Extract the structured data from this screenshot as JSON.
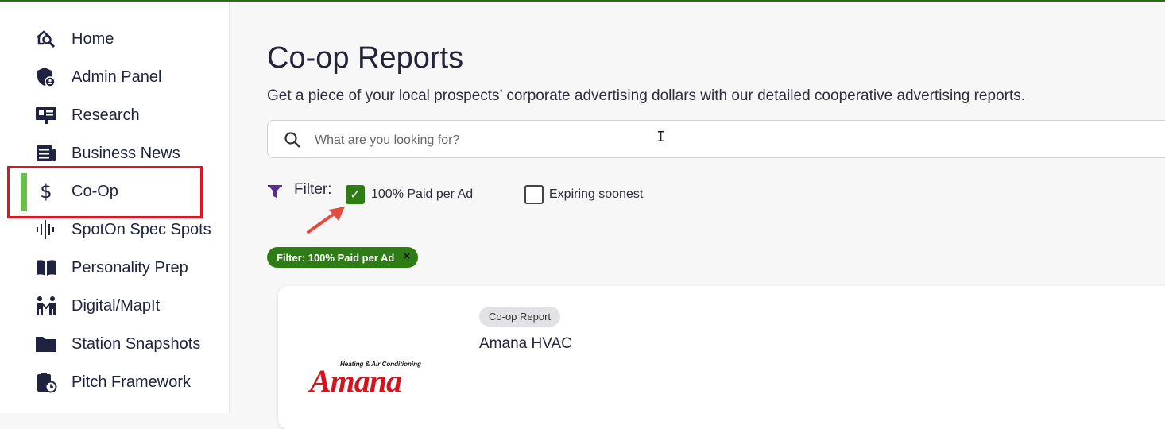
{
  "sidebar": {
    "items": [
      {
        "label": "Home",
        "icon": "home-search-icon"
      },
      {
        "label": "Admin Panel",
        "icon": "shield-user-icon"
      },
      {
        "label": "Research",
        "icon": "presentation-icon"
      },
      {
        "label": "Business News",
        "icon": "newspaper-icon"
      },
      {
        "label": "Co-Op",
        "icon": "dollar-icon",
        "active": true
      },
      {
        "label": "SpotOn Spec Spots",
        "icon": "soundwave-icon"
      },
      {
        "label": "Personality Prep",
        "icon": "open-book-icon"
      },
      {
        "label": "Digital/MapIt",
        "icon": "people-icon"
      },
      {
        "label": "Station Snapshots",
        "icon": "folder-icon"
      },
      {
        "label": "Pitch Framework",
        "icon": "clipboard-clock-icon"
      }
    ],
    "active_color": "#6abf4b",
    "highlight_color": "#e0141e"
  },
  "main": {
    "title": "Co-op Reports",
    "subtitle": "Get a piece of your local prospects’ corporate advertising dollars with our detailed cooperative advertising reports.",
    "search": {
      "placeholder": "What are you looking for?",
      "value": ""
    },
    "filter": {
      "label": "Filter:",
      "options": [
        {
          "label": "100% Paid per Ad",
          "checked": true
        },
        {
          "label": "Expiring soonest",
          "checked": false
        }
      ],
      "active_chip": "Filter: 100% Paid per Ad",
      "chip_close": "×"
    },
    "card": {
      "tag": "Co-op Report",
      "title": "Amana HVAC",
      "logo_word": "Amana",
      "logo_tagline": "Heating & Air Conditioning"
    }
  },
  "colors": {
    "accent_green": "#2e7d14",
    "filter_icon": "#5b2c8f",
    "annotation_arrow": "#e84a3c"
  }
}
